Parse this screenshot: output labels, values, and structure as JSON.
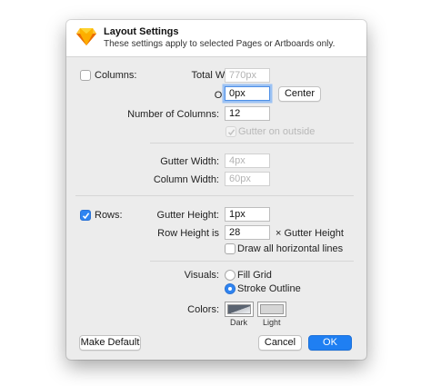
{
  "header": {
    "title": "Layout Settings",
    "subtitle": "These settings apply to selected Pages or Artboards only."
  },
  "columns": {
    "toggle_label": "Columns:",
    "checked": false,
    "total_width_label": "Total Width:",
    "total_width_value": "770px",
    "offset_label": "Offset:",
    "offset_value": "0px",
    "center_label": "Center",
    "number_label": "Number of Columns:",
    "number_value": "12",
    "gutter_outside_label": "Gutter on outside",
    "gutter_width_label": "Gutter Width:",
    "gutter_width_value": "4px",
    "column_width_label": "Column Width:",
    "column_width_value": "60px"
  },
  "rows": {
    "toggle_label": "Rows:",
    "checked": true,
    "gutter_height_label": "Gutter Height:",
    "gutter_height_value": "1px",
    "row_height_label": "Row Height is",
    "row_height_value": "28",
    "row_height_suffix": "× Gutter Height",
    "draw_all_label": "Draw all horizontal lines"
  },
  "visuals": {
    "label": "Visuals:",
    "options": [
      "Fill Grid",
      "Stroke Outline"
    ],
    "selected": "Stroke Outline"
  },
  "colors": {
    "label": "Colors:",
    "dark_label": "Dark",
    "light_label": "Light",
    "dark_color": "#5b6471",
    "light_color": "#d6d6d6"
  },
  "footer": {
    "make_default_label": "Make Default",
    "cancel_label": "Cancel",
    "ok_label": "OK"
  },
  "theme": {
    "accent": "#1f7ff2"
  }
}
